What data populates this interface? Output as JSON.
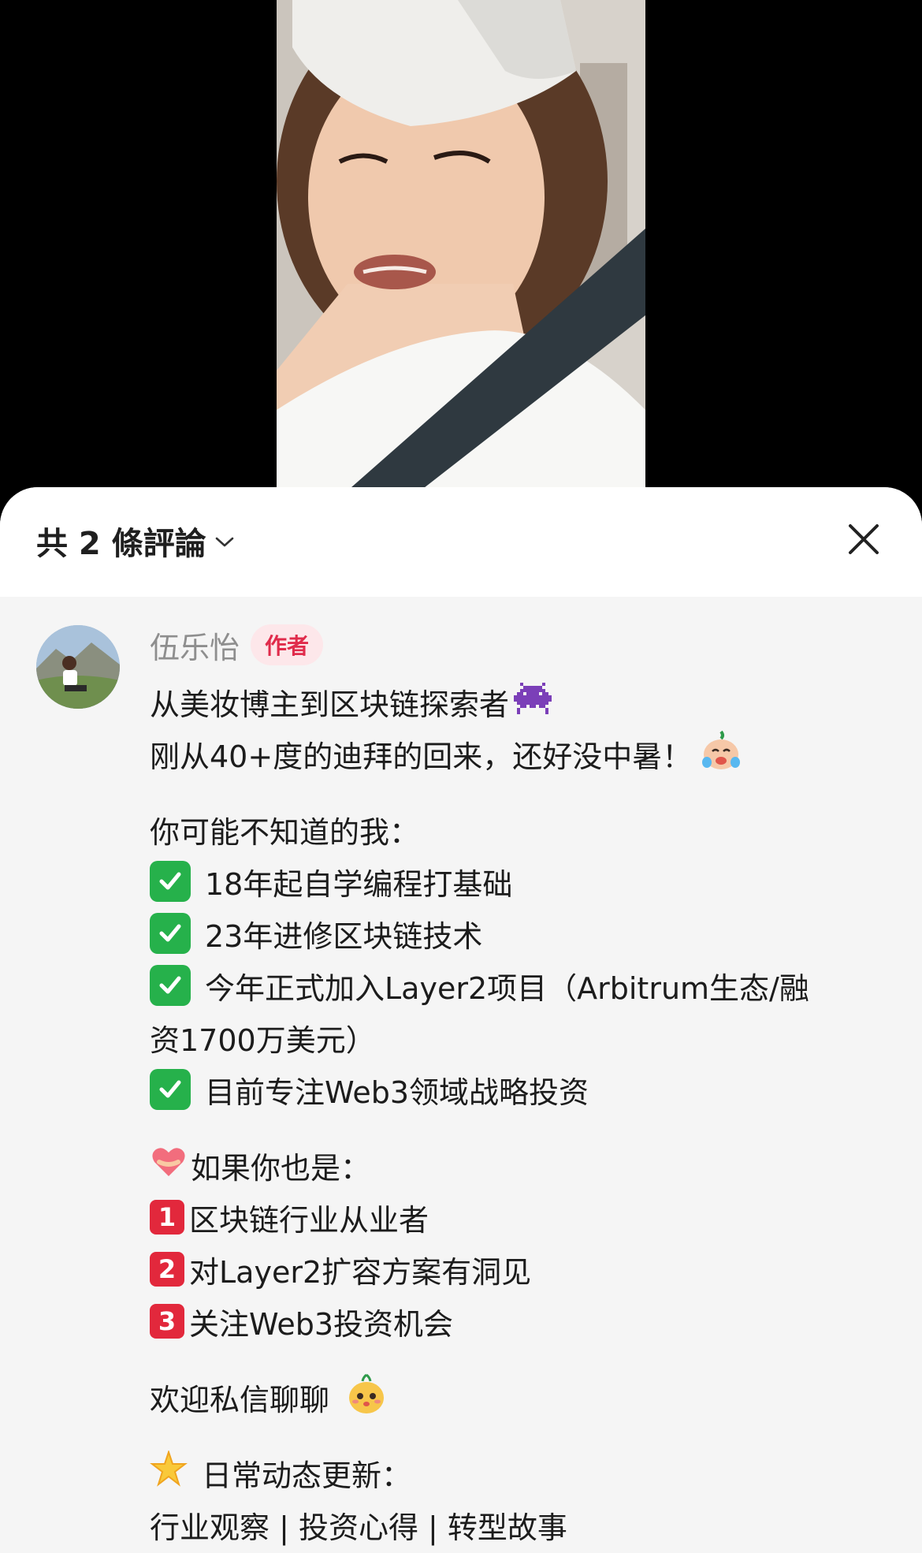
{
  "header": {
    "comment_count": "共 2 條評論"
  },
  "comment": {
    "author": "伍乐怡",
    "badge": "作者",
    "lines": {
      "l1": "从美妆博主到区块链探索者",
      "l2": "刚从40+度的迪拜的回来，还好没中暑！",
      "l3": "你可能不知道的我：",
      "l4": "18年起自学编程打基础",
      "l5": "23年进修区块链技术",
      "l6": "今年正式加入Layer2项目（Arbitrum生态/融",
      "l6b": "资1700万美元）",
      "l7": "目前专注Web3领域战略投资",
      "l8": "如果你也是：",
      "l9": "区块链行业从业者",
      "l10": "对Layer2扩容方案有洞见",
      "l11": "关注Web3投资机会",
      "l12": "欢迎私信聊聊",
      "l13": "日常动态更新：",
      "l14": "行业观察 | 投资心得 | 转型故事"
    },
    "number_keys": {
      "k1": "1",
      "k2": "2",
      "k3": "3"
    }
  },
  "colors": {
    "accent_red": "#e02b4b",
    "check_green": "#26b14b",
    "sheet_bg": "#f5f5f5"
  },
  "icons": [
    "chevron-down-icon",
    "close-icon",
    "alien-monster-icon",
    "crying-face-icon",
    "check-mark-icon",
    "heart-hands-icon",
    "keycap-1-icon",
    "keycap-2-icon",
    "keycap-3-icon",
    "cute-face-icon",
    "sparkle-star-icon"
  ]
}
